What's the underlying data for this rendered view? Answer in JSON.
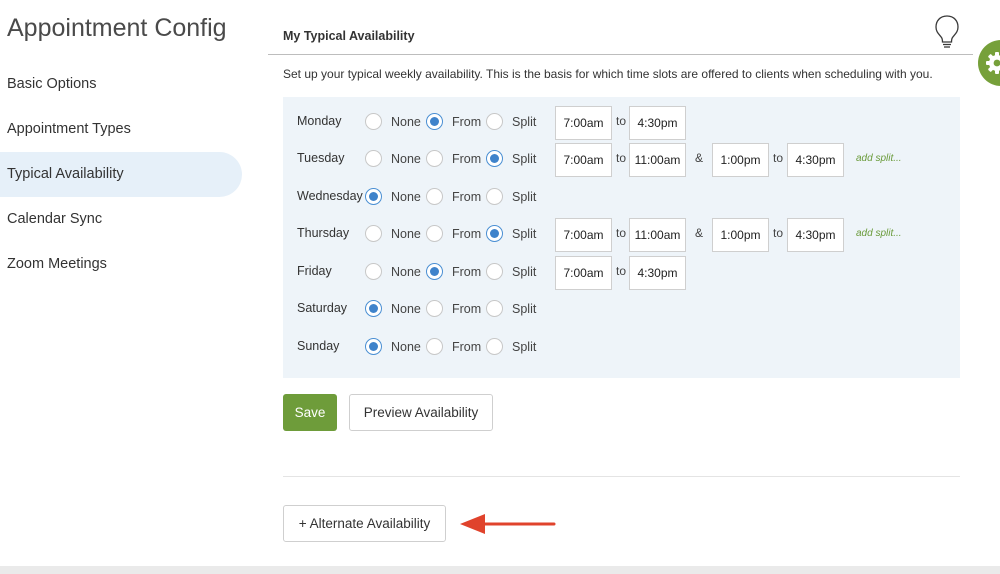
{
  "app": {
    "title": "Appointment Config"
  },
  "sidebar": {
    "items": [
      {
        "label": "Basic Options"
      },
      {
        "label": "Appointment Types"
      },
      {
        "label": "Typical Availability",
        "active": true
      },
      {
        "label": "Calendar Sync"
      },
      {
        "label": "Zoom Meetings"
      }
    ]
  },
  "section": {
    "title": "My Typical Availability",
    "intro": "Set up your typical weekly availability. This is the basis for which time slots are offered to clients when scheduling with you."
  },
  "labels": {
    "none": "None",
    "from": "From",
    "split": "Split",
    "to": "to",
    "amp": "&",
    "add_split": "add split..."
  },
  "days": [
    {
      "name": "Monday",
      "mode": "From",
      "start": "7:00am",
      "end": "4:30pm"
    },
    {
      "name": "Tuesday",
      "mode": "Split",
      "start": "7:00am",
      "end": "11:00am",
      "start2": "1:00pm",
      "end2": "4:30pm"
    },
    {
      "name": "Wednesday",
      "mode": "None"
    },
    {
      "name": "Thursday",
      "mode": "Split",
      "start": "7:00am",
      "end": "11:00am",
      "start2": "1:00pm",
      "end2": "4:30pm"
    },
    {
      "name": "Friday",
      "mode": "From",
      "start": "7:00am",
      "end": "4:30pm"
    },
    {
      "name": "Saturday",
      "mode": "None"
    },
    {
      "name": "Sunday",
      "mode": "None"
    }
  ],
  "buttons": {
    "save": "Save",
    "preview": "Preview Availability",
    "alternate": "+ Alternate Availability"
  },
  "colors": {
    "accent_green": "#6e9c3a",
    "radio_blue": "#3f83cb",
    "active_nav_bg": "#e6f0f9",
    "panel_bg": "#eef4f9",
    "arrow_red": "#e0432c"
  },
  "icons": {
    "help": "lightbulb-icon",
    "settings": "gear-icon",
    "callout": "red-arrow-icon"
  }
}
